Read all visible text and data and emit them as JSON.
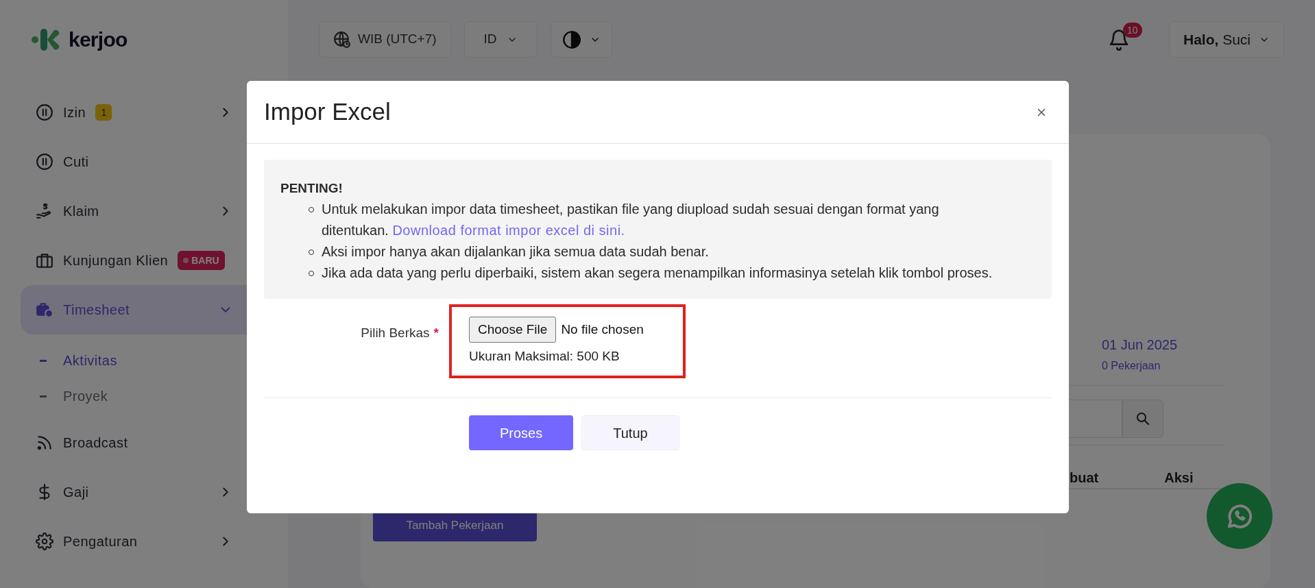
{
  "logo": {
    "text": "kerjoo"
  },
  "topbar": {
    "timezone": "WIB (UTC+7)",
    "language": "ID",
    "notifications": "10",
    "greeting": "**Halo,** Suci"
  },
  "sidebar": {
    "items": [
      {
        "label": "Izin",
        "badge": {
          "text": "1",
          "kind": "count"
        },
        "submenu": true,
        "expanded": false,
        "selected": false
      },
      {
        "label": "Cuti",
        "submenu": false,
        "selected": false
      },
      {
        "label": "Klaim",
        "submenu": true,
        "expanded": false,
        "selected": false
      },
      {
        "label": "Kunjungan Klien",
        "badge": {
          "text": "BARU",
          "kind": "new"
        },
        "submenu": false,
        "selected": false
      },
      {
        "label": "Timesheet",
        "submenu": true,
        "expanded": true,
        "selected": true,
        "children": [
          {
            "label": "Aktivitas",
            "selected": true
          },
          {
            "label": "Proyek",
            "selected": false
          }
        ]
      },
      {
        "label": "Broadcast",
        "submenu": false,
        "selected": false
      },
      {
        "label": "Gaji",
        "submenu": true,
        "expanded": false,
        "selected": false
      },
      {
        "label": "Pengaturan",
        "submenu": true,
        "expanded": false,
        "selected": false
      }
    ]
  },
  "background": {
    "date": "01 Jun 2025",
    "count": "0 Pekerjaan",
    "columns": [
      "buat",
      "Aksi"
    ],
    "add_button": "Tambah Pekerjaan"
  },
  "modal": {
    "title": "Impor Excel",
    "notice": {
      "heading": "PENTING!",
      "items": [
        {
          "text": "Untuk melakukan impor data timesheet, pastikan file yang diupload sudah sesuai dengan format yang ditentukan.",
          "link": "Download format impor excel di sini."
        },
        {
          "text": "Aksi impor hanya akan dijalankan jika semua data sudah benar."
        },
        {
          "text": "Jika ada data yang perlu diperbaiki, sistem akan segera menampilkan informasinya setelah klik tombol proses."
        }
      ]
    },
    "file": {
      "label": "Pilih Berkas",
      "required_mark": "*",
      "button": "Choose File",
      "status": "No file chosen",
      "hint": "Ukuran Maksimal: 500 KB",
      "highlighted": true
    },
    "buttons": [
      {
        "label": "Proses",
        "kind": "primary"
      },
      {
        "label": "Tutup",
        "kind": "secondary"
      }
    ]
  }
}
